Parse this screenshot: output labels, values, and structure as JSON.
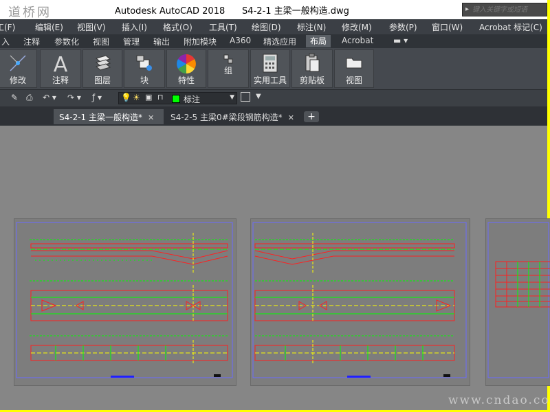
{
  "watermark_top": "道桥网",
  "title": "Autodesk AutoCAD 2018      S4-2-1 主梁一般构造.dwg",
  "search": {
    "placeholder": "键入关键字或短语"
  },
  "menu": [
    "工(F)",
    "编辑(E)",
    "视图(V)",
    "插入(I)",
    "格式(O)",
    "工具(T)",
    "绘图(D)",
    "标注(N)",
    "修改(M)",
    "参数(P)",
    "窗口(W)",
    "Acrobat 标记(C)"
  ],
  "ribbon_tabs": [
    "入",
    "注释",
    "参数化",
    "视图",
    "管理",
    "输出",
    "附加模块",
    "A360",
    "精选应用",
    "布局",
    "Acrobat"
  ],
  "ribbon_tab_active": "布局",
  "ribbon_buttons": [
    "修改",
    "注释",
    "图层",
    "块",
    "特性",
    "组",
    "实用工具",
    "剪贴板",
    "视图"
  ],
  "layer_name": "标注",
  "doc_tabs": [
    {
      "label": "S4-2-1 主梁一般构造*",
      "close": "✕"
    },
    {
      "label": "S4-2-5 主梁0#梁段钢筋构造*",
      "close": "✕"
    }
  ],
  "plus_label": "+",
  "watermark_bottom": "www.cndao.com",
  "colors": {
    "menubar": "#3b3f45",
    "ribbon": "#45494f",
    "canvas": "#868686",
    "accent_frame": "#ffff00",
    "layer_color": "#00ff00"
  }
}
